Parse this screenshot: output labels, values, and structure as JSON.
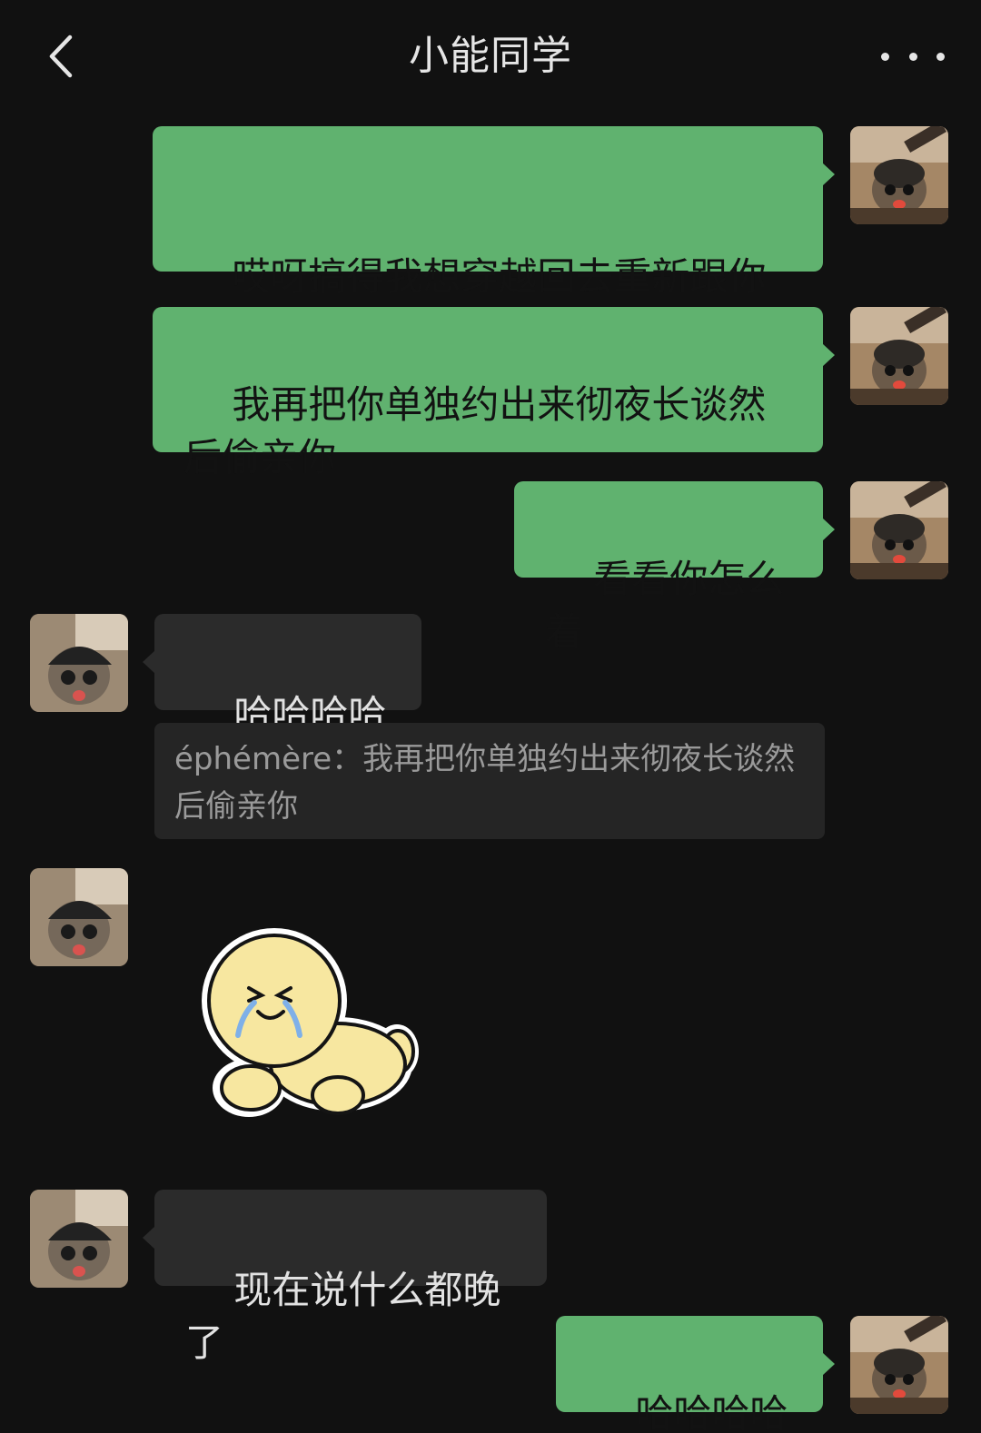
{
  "header": {
    "title": "小能同学",
    "back_icon": "chevron-left-icon",
    "more_icon": "more-dots-icon"
  },
  "colors": {
    "background": "#111111",
    "my_bubble": "#60b26f",
    "their_bubble": "#2b2b2b",
    "quote_bg": "#252525"
  },
  "messages": [
    {
      "from": "me",
      "text": "哎呀搞得我想穿越回去重新跟你暧昧一遍"
    },
    {
      "from": "me",
      "text": "我再把你单独约出来彻夜长谈然后偷亲你"
    },
    {
      "from": "me",
      "text": "看看你怎么着"
    },
    {
      "from": "them",
      "text": "哈哈哈哈哈",
      "quote": {
        "author": "éphémère",
        "text": "我再把你单独约出来彻夜长谈然后偷亲你"
      }
    },
    {
      "from": "them",
      "type": "sticker",
      "sticker": "crying-yellow-blob-sticker"
    },
    {
      "from": "them",
      "text": "现在说什么都晚了"
    },
    {
      "from": "me",
      "text": "哈哈哈哈哈"
    }
  ]
}
